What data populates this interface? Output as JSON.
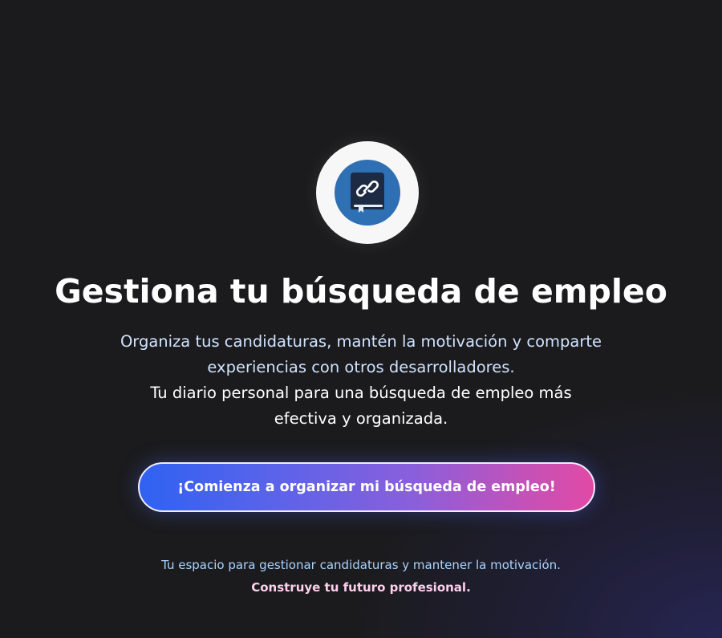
{
  "hero": {
    "logo_icon": "link-journal-icon",
    "title": "Gestiona tu búsqueda de empleo",
    "subtitle_line1": "Organiza tus candidaturas, mantén la motivación y comparte",
    "subtitle_line2": "experiencias con otros desarrolladores.",
    "subtitle_line3": "Tu diario personal para una búsqueda de empleo más",
    "subtitle_line4": "efectiva y organizada.",
    "cta_label": "¡Comienza a organizar mi búsqueda de empleo!",
    "footer_line1": "Tu espacio para gestionar candidaturas y mantener la motivación.",
    "footer_line2": "Construye tu futuro profesional."
  },
  "colors": {
    "background": "#1b1b1d",
    "logo_badge": "#2f6fb4",
    "cta_gradient_start": "#2f62f2",
    "cta_gradient_end": "#e14aa5",
    "subtitle_blue": "#cfe3ff",
    "footer_blue": "#a8d4ff",
    "footer_pink": "#ffd0ee"
  }
}
